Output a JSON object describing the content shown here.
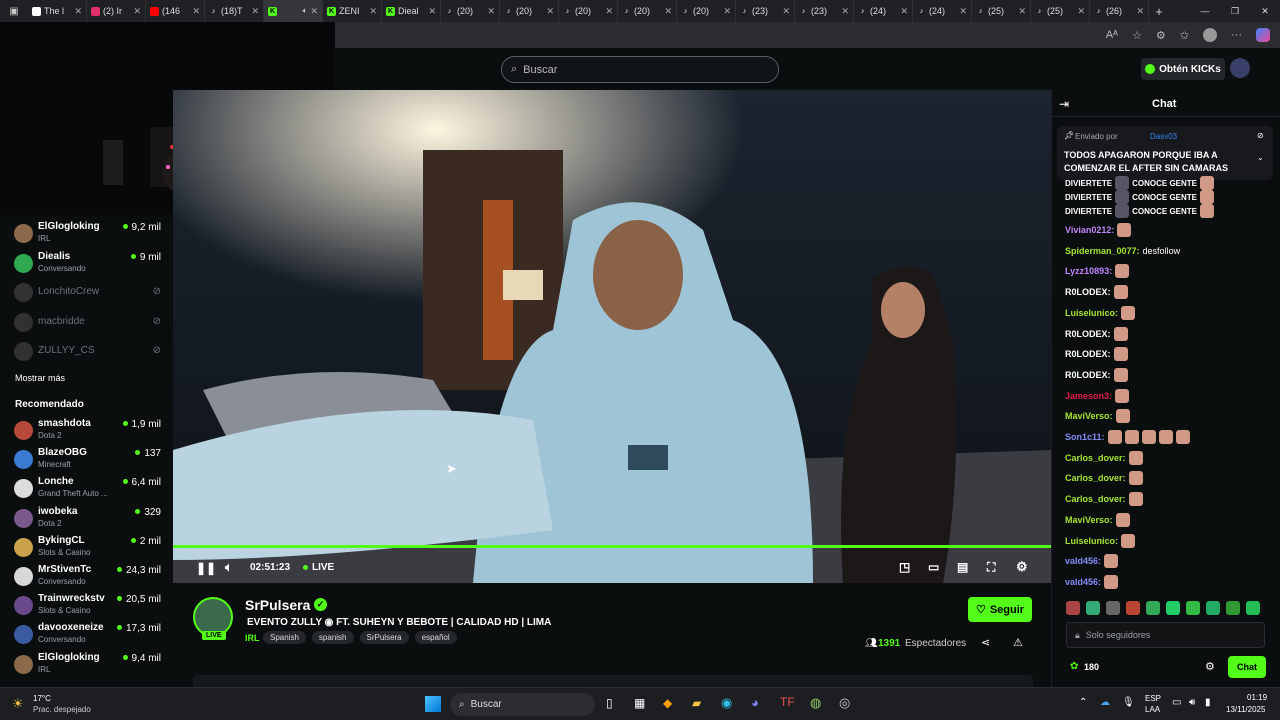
{
  "browser": {
    "tabs": [
      {
        "label": "The l",
        "icon": "shield-icon",
        "color": "#ffffff"
      },
      {
        "label": "(2) Ir",
        "icon": "instagram-icon",
        "color": "#e1306c"
      },
      {
        "label": "(146",
        "icon": "youtube-icon",
        "color": "#ff0000"
      },
      {
        "label": "(18)T",
        "icon": "tiktok-icon",
        "color": "#ffffff"
      },
      {
        "label": "",
        "icon": "kick-icon",
        "color": "#53fc18",
        "active": true
      },
      {
        "label": "ZENI",
        "icon": "kick-icon",
        "color": "#53fc18"
      },
      {
        "label": "Dieal",
        "icon": "kick-icon",
        "color": "#53fc18"
      },
      {
        "label": "(20)",
        "icon": "tiktok-icon",
        "color": "#ffffff"
      },
      {
        "label": "(20)",
        "icon": "tiktok-icon",
        "color": "#ffffff"
      },
      {
        "label": "(20)",
        "icon": "tiktok-icon",
        "color": "#ffffff"
      },
      {
        "label": "(20)",
        "icon": "tiktok-icon",
        "color": "#ffffff"
      },
      {
        "label": "(20)",
        "icon": "tiktok-icon",
        "color": "#ffffff"
      },
      {
        "label": "(23)",
        "icon": "tiktok-icon",
        "color": "#ffffff"
      },
      {
        "label": "(23)",
        "icon": "tiktok-icon",
        "color": "#ffffff"
      },
      {
        "label": "(24)",
        "icon": "tiktok-icon",
        "color": "#ffffff"
      },
      {
        "label": "(24)",
        "icon": "tiktok-icon",
        "color": "#ffffff"
      },
      {
        "label": "(25)",
        "icon": "tiktok-icon",
        "color": "#ffffff"
      },
      {
        "label": "(25)",
        "icon": "tiktok-icon",
        "color": "#ffffff"
      },
      {
        "label": "(26)",
        "icon": "tiktok-icon",
        "color": "#ffffff"
      }
    ],
    "new_tab": "+",
    "window_controls": [
      "—",
      "❐",
      "✕"
    ]
  },
  "header": {
    "search_placeholder": "Buscar",
    "get_kicks": "Obtén KICKs"
  },
  "sidebar": {
    "following": [
      {
        "name": "ElGlogloking",
        "category": "IRL",
        "viewers": "9,2 mil",
        "avatar_color": "#8a6a4a"
      },
      {
        "name": "Diealis",
        "category": "Conversando",
        "viewers": "9 mil",
        "avatar_color": "#2fa84f"
      },
      {
        "name": "LonchitoCrew",
        "category": "",
        "viewers": "",
        "offline": true,
        "avatar_color": "#555"
      },
      {
        "name": "macbridde",
        "category": "",
        "viewers": "",
        "offline": true,
        "avatar_color": "#555"
      },
      {
        "name": "ZULLYY_CS",
        "category": "",
        "viewers": "",
        "offline": true,
        "avatar_color": "#555"
      }
    ],
    "show_more": "Mostrar más",
    "recommended_title": "Recomendado",
    "recommended": [
      {
        "name": "smashdota",
        "category": "Dota 2",
        "viewers": "1,9 mil",
        "avatar_color": "#b84a3a"
      },
      {
        "name": "BlazeOBG",
        "category": "Minecraft",
        "viewers": "137",
        "avatar_color": "#3a7ad1"
      },
      {
        "name": "Lonche",
        "category": "Grand Theft Auto ...",
        "viewers": "6,4 mil",
        "avatar_color": "#dcdcdc"
      },
      {
        "name": "iwobeka",
        "category": "Dota 2",
        "viewers": "329",
        "avatar_color": "#7a5a8a"
      },
      {
        "name": "BykingCL",
        "category": "Slots & Casino",
        "viewers": "2 mil",
        "avatar_color": "#c9a24a"
      },
      {
        "name": "MrStivenTc",
        "category": "Conversando",
        "viewers": "24,3 mil",
        "avatar_color": "#d8d8d8"
      },
      {
        "name": "Trainwreckstv",
        "category": "Slots & Casino",
        "viewers": "20,5 mil",
        "avatar_color": "#6a4a8a"
      },
      {
        "name": "davooxeneize",
        "category": "Conversando",
        "viewers": "17,3 mil",
        "avatar_color": "#3a5aa1"
      },
      {
        "name": "ElGlogloking",
        "category": "IRL",
        "viewers": "9,4 mil",
        "avatar_color": "#8a6a4a"
      }
    ]
  },
  "player": {
    "time": "02:51:23",
    "live_label": "LIVE",
    "progress": 1.0
  },
  "stream": {
    "channel": "SrPulsera",
    "title": "EVENTO ZULLY ◉ FT. SUHEYN Y BEBOTE | CALIDAD HD | LIMA",
    "category": "IRL",
    "tags": [
      "Spanish",
      "spanish",
      "SrPulsera",
      "español"
    ],
    "viewers": "1391",
    "viewers_label": "Espectadores",
    "follow": "Seguir",
    "live_badge": "LIVE"
  },
  "chat": {
    "title": "Chat",
    "pinned_by": "Enviado por",
    "pinned_user": "Dasv03",
    "pinned_text": "TODOS APAGARON PORQUE IBA A COMENZAR EL AFTER SIN CAMARAS",
    "messages": [
      {
        "user": "",
        "text": "DIVIERTETE",
        "extra": "CONOCE GENTE",
        "color": "#ffffff"
      },
      {
        "user": "",
        "text": "DIVIERTETE",
        "extra": "CONOCE GENTE",
        "color": "#ffffff"
      },
      {
        "user": "",
        "text": "DIVIERTETE",
        "extra": "CONOCE GENTE",
        "color": "#ffffff"
      },
      {
        "user": "Vivian0212:",
        "text": "",
        "emotes": 1,
        "color": "#c084fc"
      },
      {
        "user": "Spiderman_0077:",
        "text": "desfollow",
        "color": "#a3e635"
      },
      {
        "user": "Lyzz10893:",
        "text": "",
        "emotes": 1,
        "color": "#c084fc"
      },
      {
        "user": "R0LODEX:",
        "text": "",
        "emotes": 1,
        "color": "#ffffff"
      },
      {
        "user": "Luiselunico:",
        "text": "",
        "emotes": 1,
        "color": "#a3e635"
      },
      {
        "user": "R0LODEX:",
        "text": "",
        "emotes": 1,
        "color": "#ffffff"
      },
      {
        "user": "R0LODEX:",
        "text": "",
        "emotes": 1,
        "color": "#ffffff"
      },
      {
        "user": "R0LODEX:",
        "text": "",
        "emotes": 1,
        "color": "#ffffff"
      },
      {
        "user": "Jameson3:",
        "text": "",
        "emotes": 1,
        "color": "#e11d48"
      },
      {
        "user": "MaviVerso:",
        "text": "",
        "emotes": 1,
        "color": "#a3e635"
      },
      {
        "user": "Son1c11:",
        "text": "",
        "emotes": 5,
        "color": "#818cf8"
      },
      {
        "user": "Carlos_dover:",
        "text": "",
        "emotes": 1,
        "color": "#a3e635"
      },
      {
        "user": "Carlos_dover:",
        "text": "",
        "emotes": 1,
        "color": "#a3e635"
      },
      {
        "user": "Carlos_dover:",
        "text": "",
        "emotes": 1,
        "color": "#a3e635"
      },
      {
        "user": "MaviVerso:",
        "text": "",
        "emotes": 1,
        "color": "#a3e635"
      },
      {
        "user": "Luiselunico:",
        "text": "",
        "emotes": 1,
        "color": "#a3e635"
      },
      {
        "user": "vald456:",
        "text": "",
        "emotes": 1,
        "color": "#818cf8"
      },
      {
        "user": "vald456:",
        "text": "",
        "emotes": 1,
        "color": "#818cf8"
      }
    ],
    "input_placeholder": "Solo seguidores",
    "points": "180",
    "send": "Chat"
  },
  "taskbar": {
    "weather_temp": "17°C",
    "weather_desc": "Prac. despejado",
    "search": "Buscar",
    "lang": "ESP",
    "lang2": "LAA",
    "time": "01:19",
    "date": "13/11/2025"
  },
  "colors": {
    "kick_green": "#53fc18",
    "bg": "#0b0e0f"
  }
}
